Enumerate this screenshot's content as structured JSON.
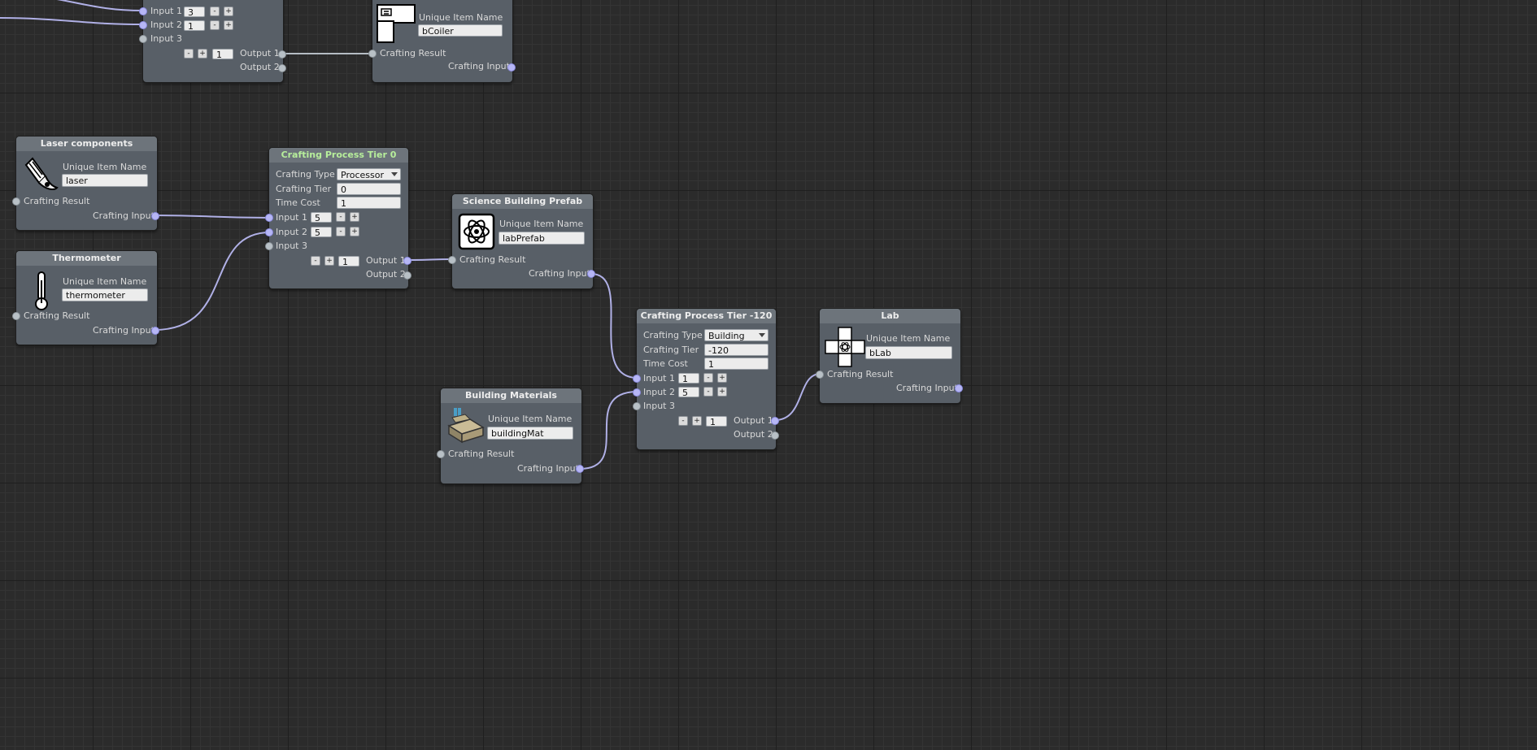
{
  "nodes": {
    "coilerCraft": {
      "input1_label": "Input 1",
      "input1_value": "3",
      "input2_label": "Input 2",
      "input2_value": "1",
      "input3_label": "Input 3",
      "output_count": "1",
      "output1_label": "Output 1",
      "output2_label": "Output 2",
      "minus": "-",
      "plus": "+"
    },
    "coilerItem": {
      "field_label": "Unique Item Name",
      "field_value": "bCoiler",
      "result_label": "Crafting Result",
      "input_label": "Crafting Input"
    },
    "laser": {
      "title": "Laser components",
      "field_label": "Unique Item Name",
      "field_value": "laser",
      "result_label": "Crafting Result",
      "input_label": "Crafting Input"
    },
    "thermometer": {
      "title": "Thermometer",
      "field_label": "Unique Item Name",
      "field_value": "thermometer",
      "result_label": "Crafting Result",
      "input_label": "Crafting Input"
    },
    "tier0": {
      "title": "Crafting Process Tier 0",
      "type_label": "Crafting Type",
      "type_value": "Processor De",
      "tier_label": "Crafting Tier",
      "tier_value": "0",
      "time_label": "Time Cost",
      "time_value": "1",
      "input1_label": "Input 1",
      "input1_value": "5",
      "input2_label": "Input 2",
      "input2_value": "5",
      "input3_label": "Input 3",
      "output_count": "1",
      "output1_label": "Output 1",
      "output2_label": "Output 2",
      "minus": "-",
      "plus": "+"
    },
    "labPrefab": {
      "title": "Science Building Prefab",
      "field_label": "Unique Item Name",
      "field_value": "labPrefab",
      "result_label": "Crafting Result",
      "input_label": "Crafting Input"
    },
    "tierNeg120": {
      "title": "Crafting Process Tier -120",
      "type_label": "Crafting Type",
      "type_value": "Building",
      "tier_label": "Crafting Tier",
      "tier_value": "-120",
      "time_label": "Time Cost",
      "time_value": "1",
      "input1_label": "Input 1",
      "input1_value": "1",
      "input2_label": "Input 2",
      "input2_value": "5",
      "input3_label": "Input 3",
      "output_count": "1",
      "output1_label": "Output 1",
      "output2_label": "Output 2",
      "minus": "-",
      "plus": "+"
    },
    "lab": {
      "title": "Lab",
      "field_label": "Unique Item Name",
      "field_value": "bLab",
      "result_label": "Crafting Result",
      "input_label": "Crafting Input"
    },
    "buildingMat": {
      "title": "Building Materials",
      "field_label": "Unique Item Name",
      "field_value": "buildingMat",
      "result_label": "Crafting Result",
      "input_label": "Crafting Input"
    }
  },
  "icons": {
    "coiler": "coiler-icon",
    "laser": "laser-icon",
    "thermometer": "thermometer-icon",
    "labPrefab": "lab-prefab-icon",
    "lab": "lab-icon",
    "buildingMat": "building-materials-icon"
  },
  "colors": {
    "canvas": "#2b2b2b",
    "node": "#585f67",
    "header": "#6d747b",
    "header_green_text": "#b7ee9b",
    "wire": "#b0b0e6",
    "port_connected": "#b6b6f5"
  }
}
